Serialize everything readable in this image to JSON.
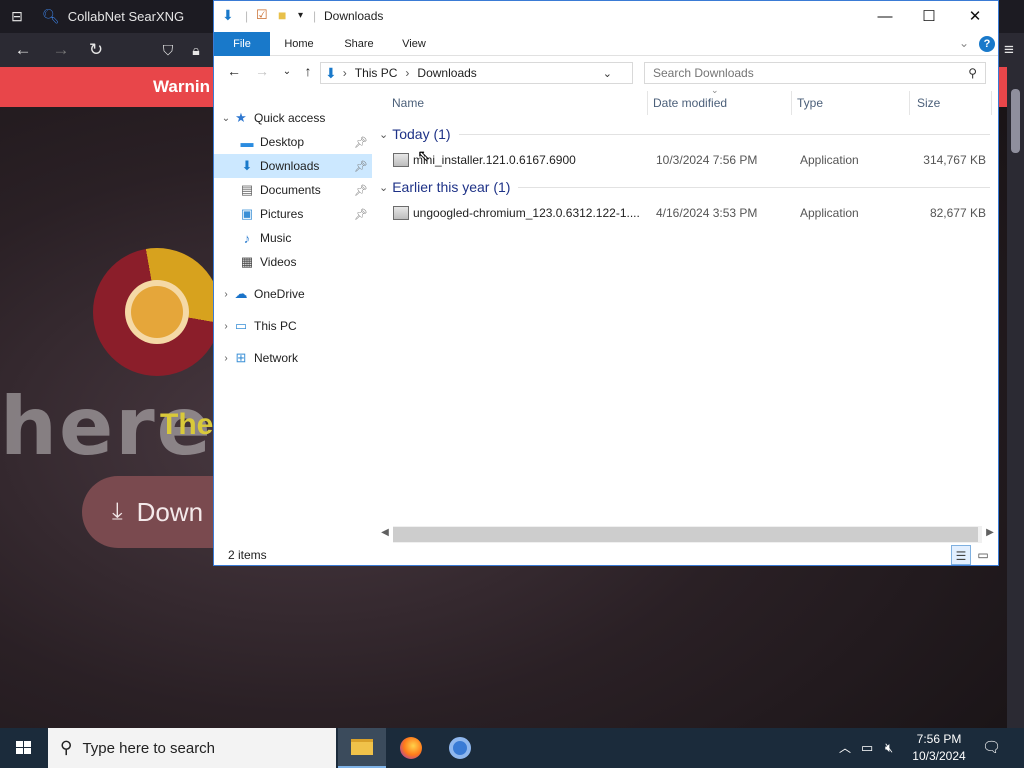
{
  "browser": {
    "tab_title": "CollabNet SearXNG",
    "warning_text": "Warnin",
    "hero_text": "here",
    "tagline": "The",
    "download_label": "Down"
  },
  "explorer": {
    "title": "Downloads",
    "window_controls": {
      "minimize": "—",
      "maximize": "☐",
      "close": "✕"
    },
    "ribbon_tabs": [
      "File",
      "Home",
      "Share",
      "View"
    ],
    "help_label": "?",
    "address": {
      "segments": [
        "This PC",
        "Downloads"
      ]
    },
    "search": {
      "placeholder": "Search Downloads"
    },
    "nav": {
      "quick_access": "Quick access",
      "pinned": [
        {
          "label": "Desktop",
          "icon": "desktop-icon",
          "pinned": true
        },
        {
          "label": "Downloads",
          "icon": "downloads-icon",
          "pinned": true,
          "selected": true
        },
        {
          "label": "Documents",
          "icon": "documents-icon",
          "pinned": true
        },
        {
          "label": "Pictures",
          "icon": "pictures-icon",
          "pinned": true
        },
        {
          "label": "Music",
          "icon": "music-icon",
          "pinned": false
        },
        {
          "label": "Videos",
          "icon": "videos-icon",
          "pinned": false
        }
      ],
      "onedrive": "OneDrive",
      "this_pc": "This PC",
      "network": "Network"
    },
    "columns": {
      "name": "Name",
      "date": "Date modified",
      "type": "Type",
      "size": "Size"
    },
    "groups": [
      {
        "label": "Today (1)",
        "files": [
          {
            "name": "mini_installer.121.0.6167.6900",
            "date": "10/3/2024 7:56 PM",
            "type": "Application",
            "size": "314,767 KB"
          }
        ]
      },
      {
        "label": "Earlier this year (1)",
        "files": [
          {
            "name": "ungoogled-chromium_123.0.6312.122-1....",
            "date": "4/16/2024 3:53 PM",
            "type": "Application",
            "size": "82,677 KB"
          }
        ]
      }
    ],
    "status": {
      "item_count": "2 items"
    }
  },
  "taskbar": {
    "search_placeholder": "Type here to search",
    "time": "7:56 PM",
    "date": "10/3/2024"
  },
  "colors": {
    "accent": "#1979ca",
    "selection": "#cce8ff",
    "warning_banner": "#e8464a",
    "taskbar": "#1b2b3b"
  }
}
